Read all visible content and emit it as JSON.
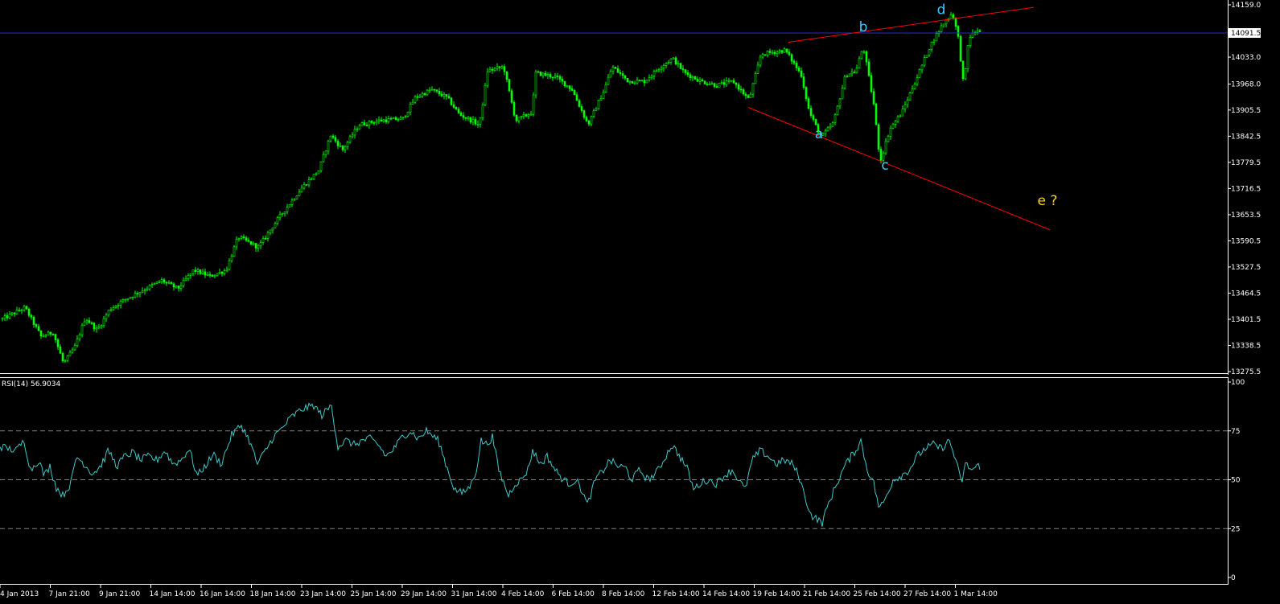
{
  "chart_data": {
    "type": "candlestick",
    "timeframe_hint": "H1",
    "current_price": "14091.5",
    "price_axis": {
      "ylim": [
        13260,
        14170
      ],
      "ticks": [
        "14159.0",
        "14096.0",
        "14033.0",
        "13968.0",
        "13905.5",
        "13842.5",
        "13779.5",
        "13716.5",
        "13653.5",
        "13590.5",
        "13527.5",
        "13464.5",
        "13401.5",
        "13338.5",
        "13275.5"
      ]
    },
    "time_axis": {
      "labels": [
        "4 Jan 2013",
        "7 Jan 21:00",
        "9 Jan 21:00",
        "14 Jan 14:00",
        "16 Jan 14:00",
        "18 Jan 14:00",
        "23 Jan 14:00",
        "25 Jan 14:00",
        "29 Jan 14:00",
        "31 Jan 14:00",
        "4 Feb 14:00",
        "6 Feb 14:00",
        "8 Feb 14:00",
        "12 Feb 14:00",
        "14 Feb 14:00",
        "19 Feb 14:00",
        "21 Feb 14:00",
        "25 Feb 14:00",
        "27 Feb 14:00",
        "1 Mar 14:00"
      ]
    },
    "price_path": [
      [
        0,
        13400
      ],
      [
        30,
        13430
      ],
      [
        50,
        13360
      ],
      [
        65,
        13370
      ],
      [
        78,
        13295
      ],
      [
        92,
        13335
      ],
      [
        105,
        13405
      ],
      [
        120,
        13375
      ],
      [
        135,
        13425
      ],
      [
        155,
        13450
      ],
      [
        175,
        13470
      ],
      [
        200,
        13495
      ],
      [
        220,
        13475
      ],
      [
        240,
        13520
      ],
      [
        260,
        13505
      ],
      [
        280,
        13520
      ],
      [
        295,
        13600
      ],
      [
        320,
        13575
      ],
      [
        345,
        13645
      ],
      [
        375,
        13720
      ],
      [
        395,
        13760
      ],
      [
        410,
        13845
      ],
      [
        425,
        13810
      ],
      [
        445,
        13870
      ],
      [
        470,
        13880
      ],
      [
        500,
        13885
      ],
      [
        515,
        13935
      ],
      [
        535,
        13955
      ],
      [
        555,
        13935
      ],
      [
        570,
        13895
      ],
      [
        595,
        13870
      ],
      [
        605,
        14000
      ],
      [
        625,
        14010
      ],
      [
        640,
        13880
      ],
      [
        660,
        13900
      ],
      [
        665,
        13995
      ],
      [
        690,
        13985
      ],
      [
        710,
        13955
      ],
      [
        730,
        13870
      ],
      [
        750,
        13955
      ],
      [
        760,
        14010
      ],
      [
        780,
        13975
      ],
      [
        800,
        13975
      ],
      [
        820,
        14010
      ],
      [
        835,
        14030
      ],
      [
        850,
        13995
      ],
      [
        870,
        13975
      ],
      [
        890,
        13965
      ],
      [
        910,
        13975
      ],
      [
        930,
        13930
      ],
      [
        945,
        14040
      ],
      [
        975,
        14050
      ],
      [
        995,
        13990
      ],
      [
        1005,
        13900
      ],
      [
        1020,
        13840
      ],
      [
        1035,
        13875
      ],
      [
        1050,
        13990
      ],
      [
        1063,
        14000
      ],
      [
        1072,
        14060
      ],
      [
        1085,
        13920
      ],
      [
        1093,
        13780
      ],
      [
        1105,
        13860
      ],
      [
        1120,
        13900
      ],
      [
        1140,
        13990
      ],
      [
        1155,
        14060
      ],
      [
        1170,
        14110
      ],
      [
        1183,
        14140
      ],
      [
        1190,
        14080
      ],
      [
        1197,
        13960
      ],
      [
        1203,
        14080
      ],
      [
        1215,
        14100
      ],
      [
        1219,
        14085
      ]
    ],
    "trend_lines": [
      {
        "color": "#ff0000",
        "from": [
          930,
          13912
        ],
        "to": [
          1305,
          13617
        ]
      },
      {
        "color": "#ff0000",
        "from": [
          980,
          14069
        ],
        "to": [
          1285,
          14153
        ]
      }
    ],
    "wave_labels": [
      {
        "text": "a",
        "at": [
          1018,
          13837
        ],
        "color": "#40c8ff"
      },
      {
        "text": "b",
        "at": [
          1073,
          14095
        ],
        "color": "#40c8ff"
      },
      {
        "text": "c",
        "at": [
          1100,
          13762
        ],
        "color": "#40c8ff"
      },
      {
        "text": "d",
        "at": [
          1170,
          14137
        ],
        "color": "#40c8ff"
      },
      {
        "text": "e ?",
        "at": [
          1302,
          13677
        ],
        "color": "#ffd700"
      }
    ],
    "indicator": {
      "name": "RSI(14)",
      "value": "56.9034",
      "ylim": [
        0,
        100
      ],
      "levels": [
        75,
        50,
        25
      ],
      "ticks": [
        "100",
        "75",
        "50",
        "25",
        "0"
      ],
      "line_color": "#40c8c8",
      "path": [
        [
          0,
          67
        ],
        [
          20,
          65
        ],
        [
          30,
          70
        ],
        [
          38,
          55
        ],
        [
          48,
          60
        ],
        [
          55,
          52
        ],
        [
          62,
          57
        ],
        [
          70,
          46
        ],
        [
          78,
          42
        ],
        [
          88,
          48
        ],
        [
          95,
          62
        ],
        [
          105,
          58
        ],
        [
          115,
          53
        ],
        [
          125,
          57
        ],
        [
          135,
          65
        ],
        [
          145,
          57
        ],
        [
          155,
          62
        ],
        [
          165,
          64
        ],
        [
          175,
          60
        ],
        [
          185,
          62
        ],
        [
          195,
          60
        ],
        [
          205,
          65
        ],
        [
          215,
          58
        ],
        [
          225,
          60
        ],
        [
          235,
          66
        ],
        [
          245,
          52
        ],
        [
          255,
          57
        ],
        [
          265,
          63
        ],
        [
          275,
          58
        ],
        [
          288,
          73
        ],
        [
          300,
          78
        ],
        [
          310,
          70
        ],
        [
          320,
          58
        ],
        [
          330,
          65
        ],
        [
          340,
          72
        ],
        [
          350,
          76
        ],
        [
          362,
          82
        ],
        [
          375,
          86
        ],
        [
          390,
          88
        ],
        [
          400,
          83
        ],
        [
          412,
          88
        ],
        [
          420,
          67
        ],
        [
          430,
          70
        ],
        [
          440,
          68
        ],
        [
          450,
          70
        ],
        [
          460,
          71
        ],
        [
          470,
          68
        ],
        [
          480,
          62
        ],
        [
          490,
          66
        ],
        [
          500,
          72
        ],
        [
          510,
          75
        ],
        [
          520,
          71
        ],
        [
          530,
          75
        ],
        [
          545,
          70
        ],
        [
          555,
          57
        ],
        [
          565,
          45
        ],
        [
          575,
          43
        ],
        [
          585,
          47
        ],
        [
          592,
          55
        ],
        [
          598,
          70
        ],
        [
          605,
          68
        ],
        [
          612,
          72
        ],
        [
          620,
          55
        ],
        [
          632,
          42
        ],
        [
          640,
          48
        ],
        [
          648,
          50
        ],
        [
          656,
          55
        ],
        [
          662,
          65
        ],
        [
          672,
          58
        ],
        [
          680,
          62
        ],
        [
          690,
          55
        ],
        [
          700,
          50
        ],
        [
          708,
          48
        ],
        [
          716,
          50
        ],
        [
          724,
          44
        ],
        [
          730,
          37
        ],
        [
          740,
          50
        ],
        [
          750,
          55
        ],
        [
          758,
          60
        ],
        [
          768,
          57
        ],
        [
          778,
          56
        ],
        [
          785,
          50
        ],
        [
          795,
          55
        ],
        [
          805,
          50
        ],
        [
          815,
          53
        ],
        [
          825,
          60
        ],
        [
          835,
          68
        ],
        [
          845,
          62
        ],
        [
          855,
          55
        ],
        [
          862,
          45
        ],
        [
          870,
          48
        ],
        [
          880,
          50
        ],
        [
          890,
          48
        ],
        [
          900,
          52
        ],
        [
          910,
          55
        ],
        [
          918,
          50
        ],
        [
          926,
          45
        ],
        [
          935,
          60
        ],
        [
          945,
          65
        ],
        [
          955,
          62
        ],
        [
          965,
          58
        ],
        [
          975,
          60
        ],
        [
          985,
          58
        ],
        [
          993,
          52
        ],
        [
          1000,
          42
        ],
        [
          1008,
          32
        ],
        [
          1015,
          30
        ],
        [
          1022,
          28
        ],
        [
          1030,
          38
        ],
        [
          1040,
          48
        ],
        [
          1050,
          57
        ],
        [
          1058,
          62
        ],
        [
          1065,
          66
        ],
        [
          1070,
          70
        ],
        [
          1078,
          55
        ],
        [
          1085,
          50
        ],
        [
          1093,
          35
        ],
        [
          1100,
          40
        ],
        [
          1110,
          50
        ],
        [
          1120,
          52
        ],
        [
          1130,
          55
        ],
        [
          1140,
          62
        ],
        [
          1150,
          66
        ],
        [
          1160,
          68
        ],
        [
          1170,
          66
        ],
        [
          1180,
          70
        ],
        [
          1188,
          60
        ],
        [
          1195,
          48
        ],
        [
          1200,
          58
        ],
        [
          1208,
          55
        ],
        [
          1215,
          57
        ],
        [
          1219,
          57
        ]
      ]
    }
  }
}
